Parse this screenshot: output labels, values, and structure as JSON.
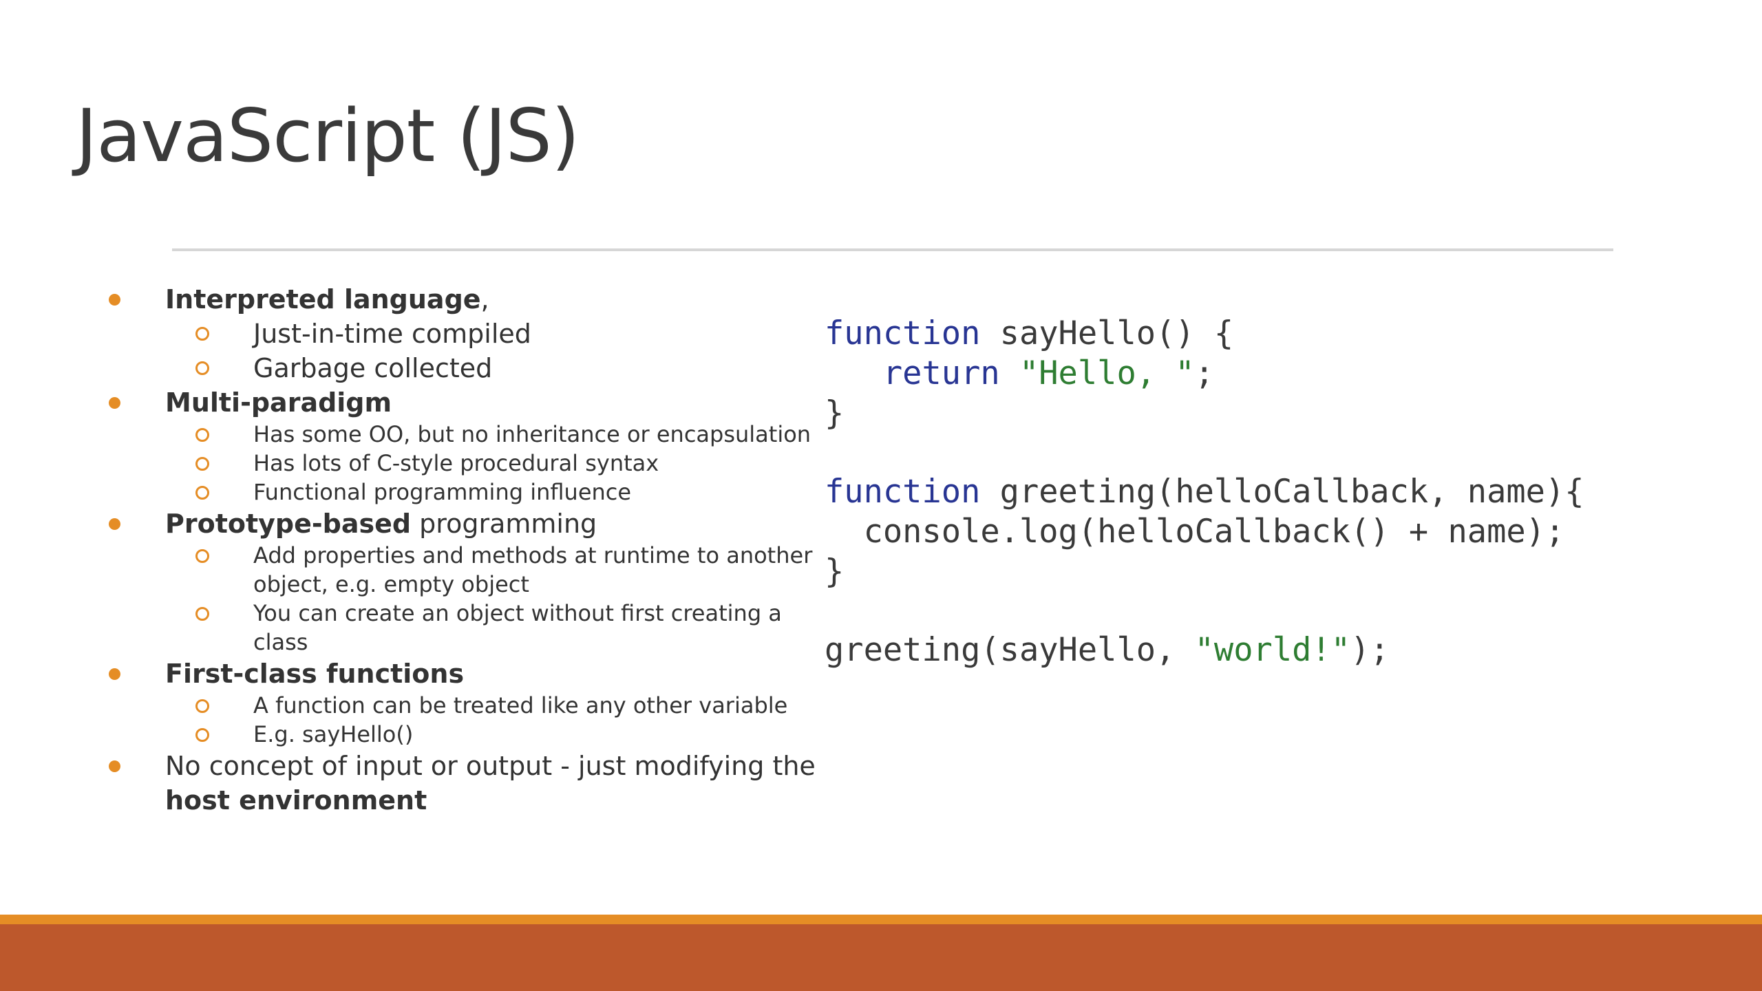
{
  "slide": {
    "title": "JavaScript (JS)",
    "bullets": [
      {
        "strong": "Interpreted language",
        "rest": ",",
        "size": "big",
        "subs": [
          "Just-in-time compiled",
          "Garbage collected"
        ]
      },
      {
        "strong": "Multi-paradigm",
        "rest": "",
        "size": "small",
        "subs": [
          "Has some OO, but no inheritance or encapsulation",
          "Has lots of C-style procedural syntax",
          "Functional programming influence"
        ]
      },
      {
        "strong": "Prototype-based",
        "rest": " programming",
        "size": "small",
        "subs": [
          "Add properties and methods at runtime to another object, e.g. empty object",
          "You can create an object without first creating a class"
        ]
      },
      {
        "strong": "First-class functions",
        "rest": "",
        "size": "small",
        "subs": [
          "A function can be treated like any other variable",
          "E.g. sayHello()"
        ]
      }
    ],
    "last_bullet": {
      "pre": "No concept of input or output - just modifying the ",
      "strong": "host environment"
    },
    "code": {
      "l1_kw": "function",
      "l1_rest": " sayHello() {",
      "l2_indent": "   ",
      "l2_kw": "return",
      "l2_str": "\"Hello, \"",
      "l2_end": ";",
      "l3": "}",
      "l4_kw": "function",
      "l4_rest": " greeting(helloCallback, name){",
      "l5": "  console.log(helloCallback() + name);",
      "l6": "}",
      "l7_pre": "greeting(sayHello, ",
      "l7_str": "\"world!\"",
      "l7_end": ");"
    }
  },
  "theme": {
    "accent": "#e58d25",
    "footer": "#bd582c",
    "keyword": "#283593",
    "string": "#2e7d32",
    "rule": "#d6d6d6"
  }
}
